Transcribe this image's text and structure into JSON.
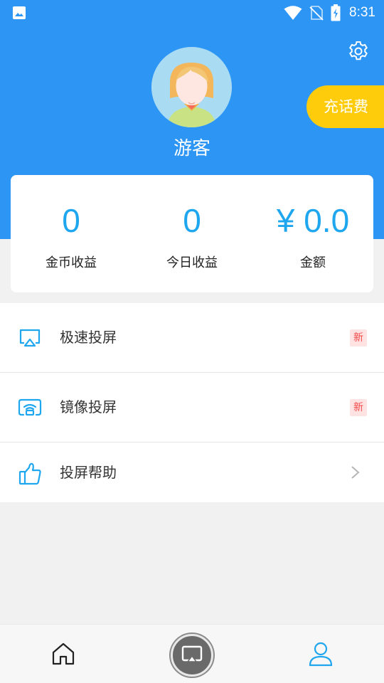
{
  "status_bar": {
    "time": "8:31",
    "icons": [
      "image-icon",
      "wifi-icon",
      "no-sim-icon",
      "battery-charging-icon"
    ]
  },
  "profile": {
    "username": "游客",
    "recharge_label": "充话费",
    "avatar_icon": "avatar-icon",
    "settings_icon": "gear-icon"
  },
  "stats": [
    {
      "value": "0",
      "label": "金币收益"
    },
    {
      "value": "0",
      "label": "今日收益"
    },
    {
      "value": "¥ 0.0",
      "label": "金额"
    }
  ],
  "menu": [
    {
      "label": "极速投屏",
      "icon": "airplay-icon",
      "badge": "新"
    },
    {
      "label": "镜像投屏",
      "icon": "mirror-cast-icon",
      "badge": "新"
    },
    {
      "label": "投屏帮助",
      "icon": "thumbs-up-icon",
      "trailing": "chevron-right-icon"
    }
  ],
  "bottom_nav": {
    "items": [
      "home-icon",
      "cast-icon",
      "profile-icon"
    ],
    "active": "profile-icon"
  },
  "colors": {
    "header_blue": "#2d96f5",
    "accent_blue": "#1ea6ef",
    "recharge_yellow": "#ffcc0c",
    "badge_red": "#f24a4a"
  }
}
